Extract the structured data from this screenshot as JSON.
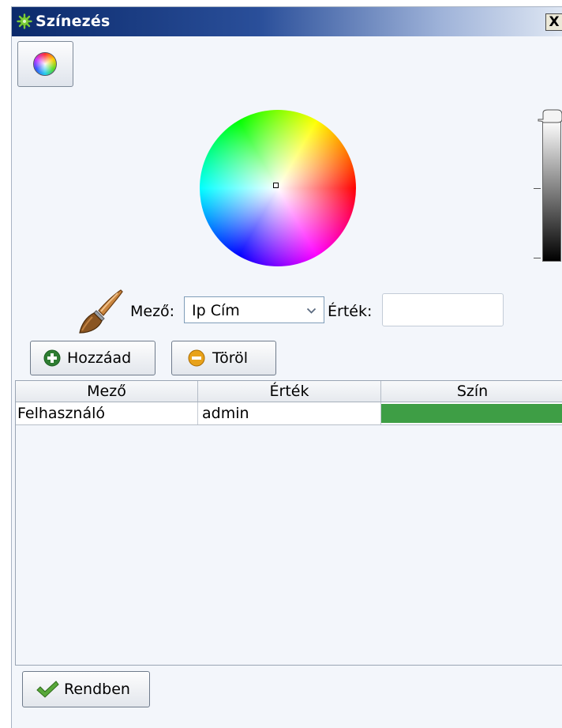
{
  "window": {
    "title": "Színezés",
    "close_label": "X"
  },
  "icons": {
    "app": "gear-icon",
    "color_mode": "color-orb-icon",
    "brush": "paint-brush-icon",
    "add": "plus-circle-icon",
    "delete": "minus-circle-icon",
    "ok": "checkmark-icon",
    "dropdown": "chevron-down-icon"
  },
  "color_picker": {
    "brightness_level": 1.0
  },
  "form": {
    "field_label": "Mező:",
    "field_selected": "Ip Cím",
    "value_label": "Érték:",
    "value_input": "",
    "value_placeholder": ""
  },
  "buttons": {
    "add": "Hozzáad",
    "delete": "Töröl",
    "ok": "Rendben"
  },
  "table": {
    "columns": [
      "Mező",
      "Érték",
      "Szín"
    ],
    "rows": [
      {
        "field": "Felhasználó",
        "value": "admin",
        "color": "#3e9e45"
      }
    ]
  },
  "colors": {
    "title_bar_start": "#0b2a6b",
    "window_bg": "#f3f6fb",
    "row_swatch": "#3e9e45",
    "add_icon": "#2e7d32",
    "delete_icon": "#e8a21a",
    "ok_icon": "#58a83a"
  }
}
